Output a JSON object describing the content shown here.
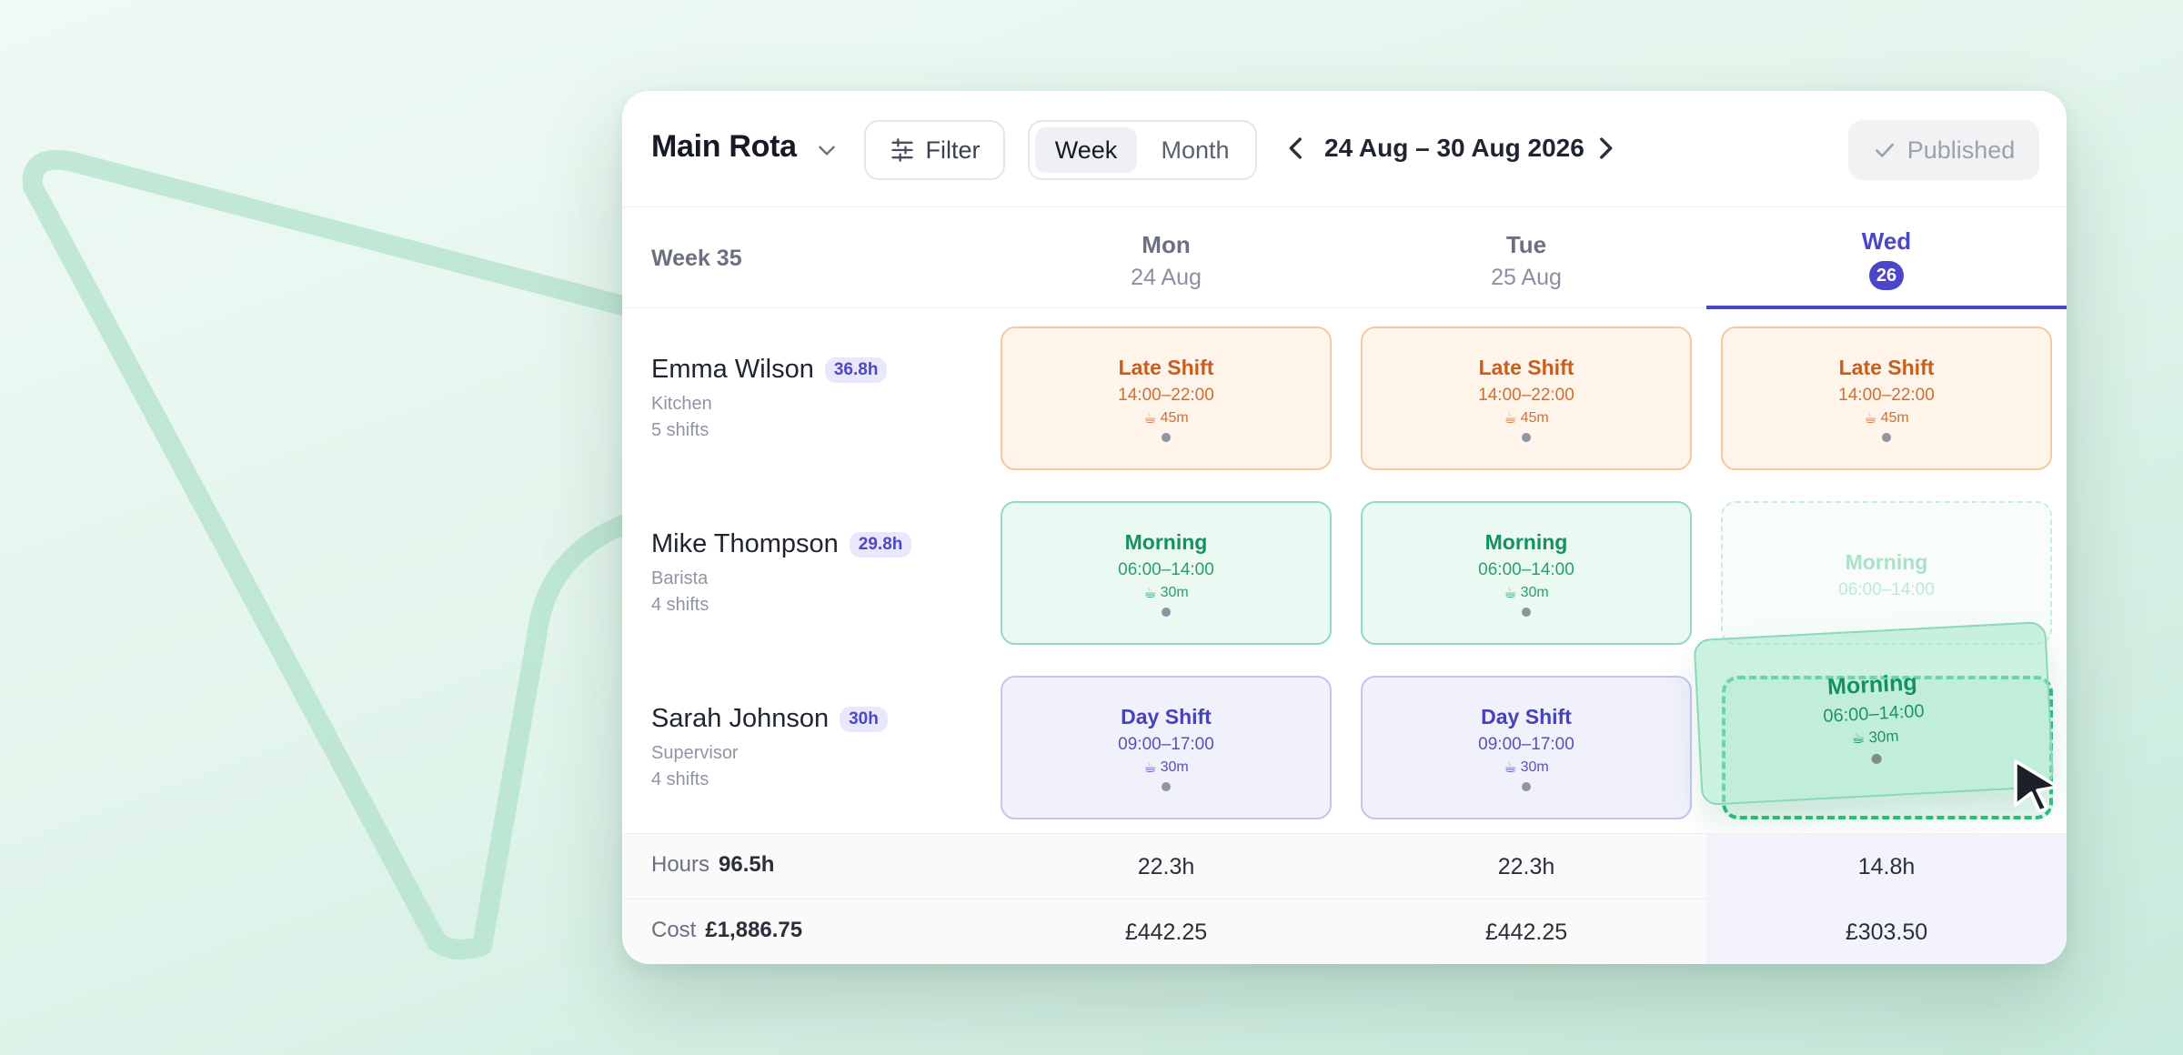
{
  "toolbar": {
    "title": "Main Rota",
    "filter_label": "Filter",
    "view_options": [
      "Week",
      "Month"
    ],
    "active_view": "Week",
    "date_range": "24 Aug – 30 Aug 2026",
    "status_label": "Published"
  },
  "header": {
    "week_label": "Week 35",
    "days": [
      {
        "name": "Mon",
        "date": "24 Aug"
      },
      {
        "name": "Tue",
        "date": "25 Aug"
      },
      {
        "name": "Wed",
        "date": "26",
        "today": true
      }
    ]
  },
  "employees": [
    {
      "name": "Emma Wilson",
      "hours": "36.8h",
      "role": "Kitchen",
      "shifts": "5 shifts"
    },
    {
      "name": "Mike Thompson",
      "hours": "29.8h",
      "role": "Barista",
      "shifts": "4 shifts"
    },
    {
      "name": "Sarah Johnson",
      "hours": "30h",
      "role": "Supervisor",
      "shifts": "4 shifts"
    }
  ],
  "shifts": {
    "late": {
      "title": "Late Shift",
      "time": "14:00–22:00",
      "break": "45m"
    },
    "morning": {
      "title": "Morning",
      "time": "06:00–14:00",
      "break": "30m"
    },
    "day": {
      "title": "Day Shift",
      "time": "09:00–17:00",
      "break": "30m"
    }
  },
  "drag": {
    "title": "Morning",
    "time": "06:00–14:00",
    "break": "30m"
  },
  "footer": {
    "hours": {
      "label": "Hours",
      "total": "96.5h",
      "values": [
        "22.3h",
        "22.3h",
        "14.8h"
      ]
    },
    "cost": {
      "label": "Cost",
      "total": "£1,886.75",
      "values": [
        "£442.25",
        "£442.25",
        "£303.50"
      ]
    }
  },
  "colors": {
    "accent": "#4b46c9",
    "late": "#c85d1e",
    "morning": "#13935b",
    "day": "#4643b8",
    "drop": "#2cc07c"
  }
}
